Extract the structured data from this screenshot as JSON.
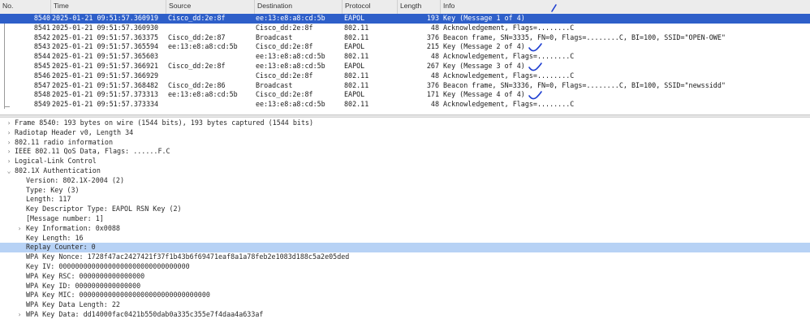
{
  "columns": [
    "No.",
    "Time",
    "Source",
    "Destination",
    "Protocol",
    "Length",
    "Info"
  ],
  "packets": [
    {
      "no": "8540",
      "time": "2025-01-21 09:51:57.360919",
      "src": "Cisco_dd:2e:8f",
      "dst": "ee:13:e8:a8:cd:5b",
      "proto": "EAPOL",
      "len": "193",
      "info": "Key (Message 1 of 4)",
      "selected": true
    },
    {
      "no": "8541",
      "time": "2025-01-21 09:51:57.360930",
      "src": "",
      "dst": "Cisco_dd:2e:8f",
      "proto": "802.11",
      "len": "48",
      "info": "Acknowledgement, Flags=........C"
    },
    {
      "no": "8542",
      "time": "2025-01-21 09:51:57.363375",
      "src": "Cisco_dd:2e:87",
      "dst": "Broadcast",
      "proto": "802.11",
      "len": "376",
      "info": "Beacon frame, SN=3335, FN=0, Flags=........C, BI=100, SSID=\"OPEN-OWE\""
    },
    {
      "no": "8543",
      "time": "2025-01-21 09:51:57.365594",
      "src": "ee:13:e8:a8:cd:5b",
      "dst": "Cisco_dd:2e:8f",
      "proto": "EAPOL",
      "len": "215",
      "info": "Key (Message 2 of 4)"
    },
    {
      "no": "8544",
      "time": "2025-01-21 09:51:57.365603",
      "src": "",
      "dst": "ee:13:e8:a8:cd:5b",
      "proto": "802.11",
      "len": "48",
      "info": "Acknowledgement, Flags=........C"
    },
    {
      "no": "8545",
      "time": "2025-01-21 09:51:57.366921",
      "src": "Cisco_dd:2e:8f",
      "dst": "ee:13:e8:a8:cd:5b",
      "proto": "EAPOL",
      "len": "267",
      "info": "Key (Message 3 of 4)"
    },
    {
      "no": "8546",
      "time": "2025-01-21 09:51:57.366929",
      "src": "",
      "dst": "Cisco_dd:2e:8f",
      "proto": "802.11",
      "len": "48",
      "info": "Acknowledgement, Flags=........C"
    },
    {
      "no": "8547",
      "time": "2025-01-21 09:51:57.368482",
      "src": "Cisco_dd:2e:86",
      "dst": "Broadcast",
      "proto": "802.11",
      "len": "376",
      "info": "Beacon frame, SN=3336, FN=0, Flags=........C, BI=100, SSID=\"newssidd\""
    },
    {
      "no": "8548",
      "time": "2025-01-21 09:51:57.373313",
      "src": "ee:13:e8:a8:cd:5b",
      "dst": "Cisco_dd:2e:8f",
      "proto": "EAPOL",
      "len": "171",
      "info": "Key (Message 4 of 4)"
    },
    {
      "no": "8549",
      "time": "2025-01-21 09:51:57.373334",
      "src": "",
      "dst": "ee:13:e8:a8:cd:5b",
      "proto": "802.11",
      "len": "48",
      "info": "Acknowledgement, Flags=........C"
    }
  ],
  "details": [
    {
      "text": "Frame 8540: 193 bytes on wire (1544 bits), 193 bytes captured (1544 bits)",
      "level": 0,
      "expander": "collapsed"
    },
    {
      "text": "Radiotap Header v0, Length 34",
      "level": 0,
      "expander": "collapsed"
    },
    {
      "text": "802.11 radio information",
      "level": 0,
      "expander": "collapsed"
    },
    {
      "text": "IEEE 802.11 QoS Data, Flags: ......F.C",
      "level": 0,
      "expander": "collapsed"
    },
    {
      "text": "Logical-Link Control",
      "level": 0,
      "expander": "collapsed"
    },
    {
      "text": "802.1X Authentication",
      "level": 0,
      "expander": "expanded"
    },
    {
      "text": "Version: 802.1X-2004 (2)",
      "level": 1,
      "expander": "none"
    },
    {
      "text": "Type: Key (3)",
      "level": 1,
      "expander": "none"
    },
    {
      "text": "Length: 117",
      "level": 1,
      "expander": "none"
    },
    {
      "text": "Key Descriptor Type: EAPOL RSN Key (2)",
      "level": 1,
      "expander": "none"
    },
    {
      "text": "[Message number: 1]",
      "level": 1,
      "expander": "none"
    },
    {
      "text": "Key Information: 0x0088",
      "level": 1,
      "expander": "collapsed"
    },
    {
      "text": "Key Length: 16",
      "level": 1,
      "expander": "none"
    },
    {
      "text": "Replay Counter: 0",
      "level": 1,
      "expander": "none",
      "highlighted": true
    },
    {
      "text": "WPA Key Nonce: 1728f47ac2427421f37f1b43b6f69471eaf8a1a78feb2e1083d188c5a2e05ded",
      "level": 1,
      "expander": "none"
    },
    {
      "text": "Key IV: 00000000000000000000000000000000",
      "level": 1,
      "expander": "none"
    },
    {
      "text": "WPA Key RSC: 0000000000000000",
      "level": 1,
      "expander": "none"
    },
    {
      "text": "WPA Key ID: 0000000000000000",
      "level": 1,
      "expander": "none"
    },
    {
      "text": "WPA Key MIC: 00000000000000000000000000000000",
      "level": 1,
      "expander": "none"
    },
    {
      "text": "WPA Key Data Length: 22",
      "level": 1,
      "expander": "none"
    },
    {
      "text": "WPA Key Data: dd14000fac0421b550dab0a335c355e7f4daa4a633af",
      "level": 1,
      "expander": "collapsed"
    }
  ],
  "icons": {
    "collapsed": "chevron-right-icon",
    "expanded": "chevron-down-icon"
  },
  "colors": {
    "selection": "#2e5fc9",
    "field_highlight": "#b7d2f5",
    "ink": "#1f3fd1"
  }
}
